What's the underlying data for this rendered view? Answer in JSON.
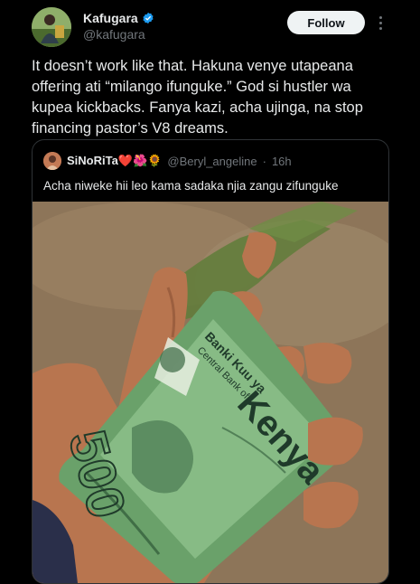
{
  "author": {
    "name": "Kafugara",
    "handle": "@kafugara",
    "verified": true
  },
  "follow_label": "Follow",
  "tweet_lines": [
    "It doesn’t work like that. Hakuna venye utapeana",
    "offering ati “milango ifunguke.” God si hustler wa",
    "kupea kickbacks. Fanya kazi, acha ujinga, na stop",
    "financing pastor’s V8 dreams."
  ],
  "quoted": {
    "name": "SiNoRiTa❤️🌺🌻",
    "handle": "@Beryl_angeline",
    "separator": "·",
    "time": "16h",
    "text": "Acha niweke hii leo kama sadaka njia zangu zifunguke",
    "banknote": {
      "bank_line1": "Banki Kuu ya",
      "bank_line2": "Central Bank of",
      "country": "Kenya",
      "denomination": "500"
    }
  },
  "colors": {
    "background": "#000000",
    "text_primary": "#e7e9ea",
    "text_secondary": "#71767b",
    "verified_blue": "#1d9bf0",
    "follow_bg": "#eff3f4",
    "border": "#2f3336"
  }
}
